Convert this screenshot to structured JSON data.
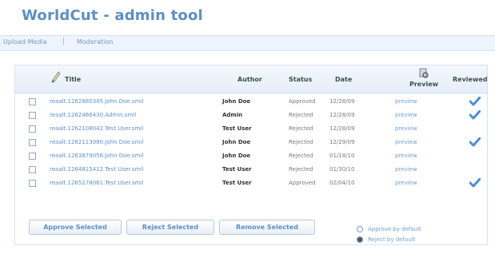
{
  "app": {
    "title": "WorldCut - admin tool"
  },
  "nav": {
    "items": [
      {
        "label": "Upload Media"
      },
      {
        "label": "Moderation"
      }
    ],
    "separator": "|"
  },
  "table": {
    "headers": {
      "title": "Title",
      "author": "Author",
      "status": "Status",
      "date": "Date",
      "preview": "Preview",
      "reviewed": "Reviewed"
    },
    "rows": [
      {
        "title": "reaalt.1262880345.John Doe.smil",
        "author": "John Doe",
        "status": "Approved",
        "date": "12/28/09",
        "preview": "preview",
        "reviewed": true
      },
      {
        "title": "reaalt.1262466430.Admin.smil",
        "author": "Admin",
        "status": "Rejected",
        "date": "12/28/09",
        "preview": "preview",
        "reviewed": true
      },
      {
        "title": "reaalt.1262108042.Test User.smil",
        "author": "Test User",
        "status": "Rejected",
        "date": "12/28/09",
        "preview": "preview",
        "reviewed": false
      },
      {
        "title": "reaalt.1262113080.John Doe.smil",
        "author": "John Doe",
        "status": "Rejected",
        "date": "12/29/09",
        "preview": "preview",
        "reviewed": true
      },
      {
        "title": "reaalt.1263879056.John Doe.smil",
        "author": "John Doe",
        "status": "Rejected",
        "date": "01/18/10",
        "preview": "preview",
        "reviewed": false
      },
      {
        "title": "reaalt.1264815412.Test User.smil",
        "author": "Test User",
        "status": "Rejected",
        "date": "01/30/10",
        "preview": "preview",
        "reviewed": false
      },
      {
        "title": "reaalt.1265278061.Test User.smil",
        "author": "Test User",
        "status": "Approved",
        "date": "02/04/10",
        "preview": "preview",
        "reviewed": true
      }
    ]
  },
  "actions": {
    "approve": "Approve Selected",
    "reject": "Reject Selected",
    "remove": "Remove Selected"
  },
  "defaults": {
    "approve_label": "Approve by default",
    "reject_label": "Reject by default",
    "selected": "reject"
  },
  "colors": {
    "accent": "#5c8fc6",
    "link": "#6f9fd8",
    "check": "#4a8fd8"
  }
}
